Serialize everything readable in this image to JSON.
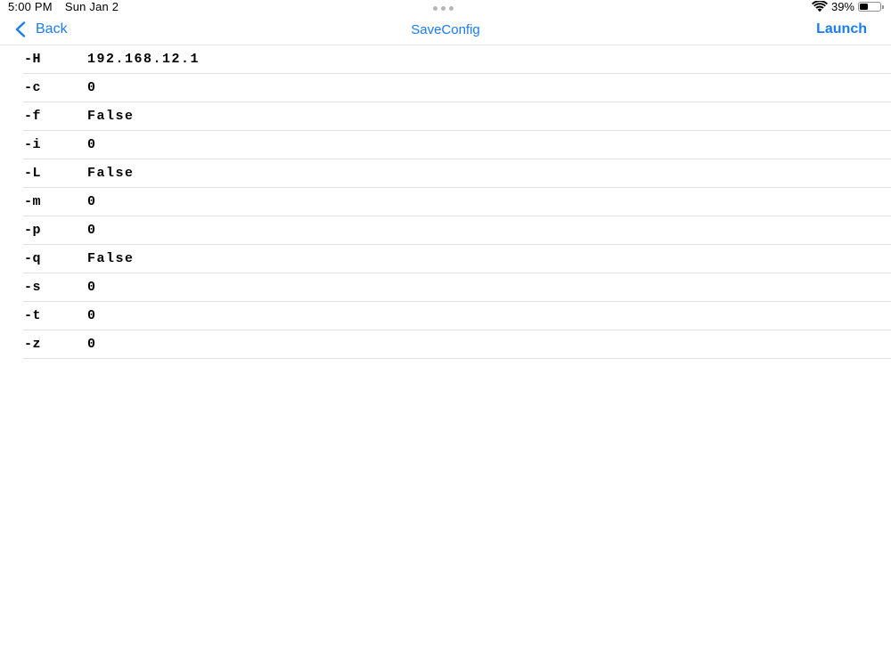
{
  "status_bar": {
    "time": "5:00 PM",
    "date": "Sun Jan 2",
    "battery_percent": "39%",
    "battery_level": 0.39,
    "icons": [
      "wifi-icon",
      "battery-icon",
      "multitask-dots-icon"
    ]
  },
  "nav": {
    "back_label": "Back",
    "title": "SaveConfig",
    "launch_label": "Launch",
    "accent_color": "#1a7cf5"
  },
  "config": [
    {
      "flag": "-H",
      "value": "192.168.12.1"
    },
    {
      "flag": "-c",
      "value": "0"
    },
    {
      "flag": "-f",
      "value": "False"
    },
    {
      "flag": "-i",
      "value": "0"
    },
    {
      "flag": "-L",
      "value": "False"
    },
    {
      "flag": "-m",
      "value": "0"
    },
    {
      "flag": "-p",
      "value": "0"
    },
    {
      "flag": "-q",
      "value": "False"
    },
    {
      "flag": "-s",
      "value": "0"
    },
    {
      "flag": "-t",
      "value": "0"
    },
    {
      "flag": "-z",
      "value": "0"
    }
  ]
}
